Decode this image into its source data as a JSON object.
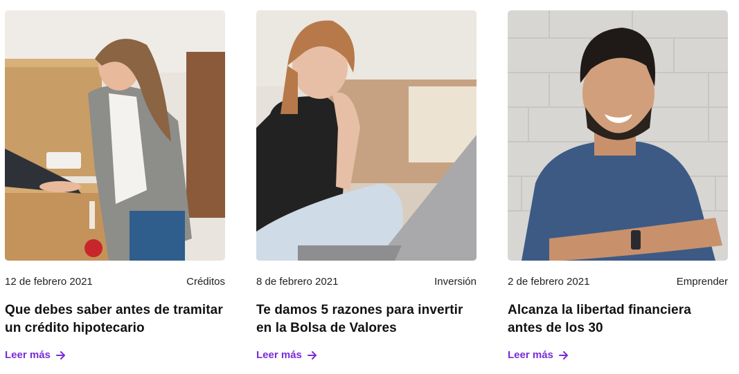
{
  "theme": {
    "accent": "#7a2bd8"
  },
  "posts": [
    {
      "date": "12 de febrero 2021",
      "category": "Créditos",
      "title": "Que debes saber antes de tramitar un crédito hipotecario",
      "link_label": "Leer más",
      "image_icon": "woman-laptop-boxes-photo"
    },
    {
      "date": "8 de febrero 2021",
      "category": "Inversión",
      "title": "Te damos 5 razones para invertir en la Bolsa de Valores",
      "link_label": "Leer más",
      "image_icon": "woman-laptop-sofa-photo"
    },
    {
      "date": "2 de febrero 2021",
      "category": "Emprender",
      "title": "Alcanza la libertad financiera antes de los 30",
      "link_label": "Leer más",
      "image_icon": "smiling-man-photo"
    }
  ]
}
